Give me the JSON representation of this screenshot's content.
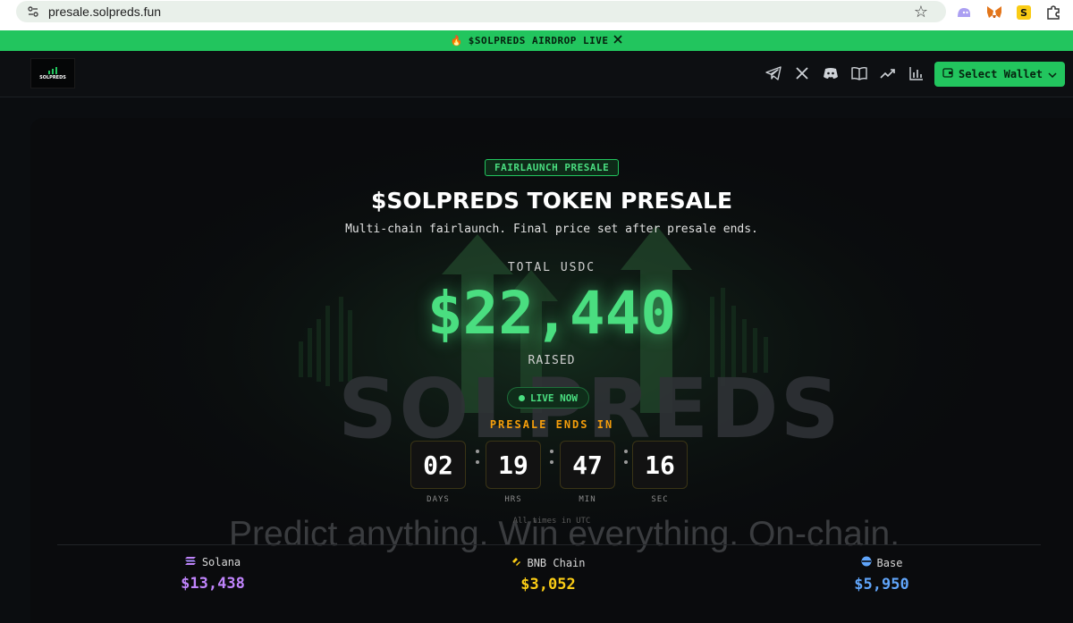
{
  "browser": {
    "url": "presale.solpreds.fun"
  },
  "banner": {
    "icon": "fire-icon",
    "text": "$SOLPREDS AIRDROP LIVE",
    "x_icon": "x-logo-icon"
  },
  "header": {
    "logo_text": "SOLPREDS",
    "nav_icons": [
      "telegram-icon",
      "x-icon",
      "discord-icon",
      "book-icon",
      "trending-icon",
      "chart-icon"
    ],
    "wallet_button": "Select Wallet"
  },
  "presale": {
    "badge": "FAIRLAUNCH PRESALE",
    "title": "$SOLPREDS TOKEN PRESALE",
    "subtitle": "Multi-chain fairlaunch. Final price set after presale ends.",
    "total_label": "TOTAL USDC",
    "amount": "$22,440",
    "raised_label": "RAISED",
    "live_label": "LIVE NOW",
    "ends_label": "PRESALE ENDS IN",
    "countdown": [
      {
        "value": "02",
        "label": "DAYS"
      },
      {
        "value": "19",
        "label": "HRS"
      },
      {
        "value": "47",
        "label": "MIN"
      },
      {
        "value": "16",
        "label": "SEC"
      }
    ],
    "utc_note": "All times in UTC",
    "background_word": "SOLPREDS",
    "background_tagline": "Predict anything. Win everything. On-chain."
  },
  "chains": [
    {
      "name": "Solana",
      "value": "$13,438",
      "color": "#c084fc",
      "icon": "solana-icon"
    },
    {
      "name": "BNB Chain",
      "value": "$3,052",
      "color": "#facc15",
      "icon": "bnb-icon"
    },
    {
      "name": "Base",
      "value": "$5,950",
      "color": "#60a5fa",
      "icon": "base-icon"
    }
  ],
  "colors": {
    "accent": "#22c55e",
    "amount": "#4ade80",
    "warning": "#f59e0b"
  }
}
